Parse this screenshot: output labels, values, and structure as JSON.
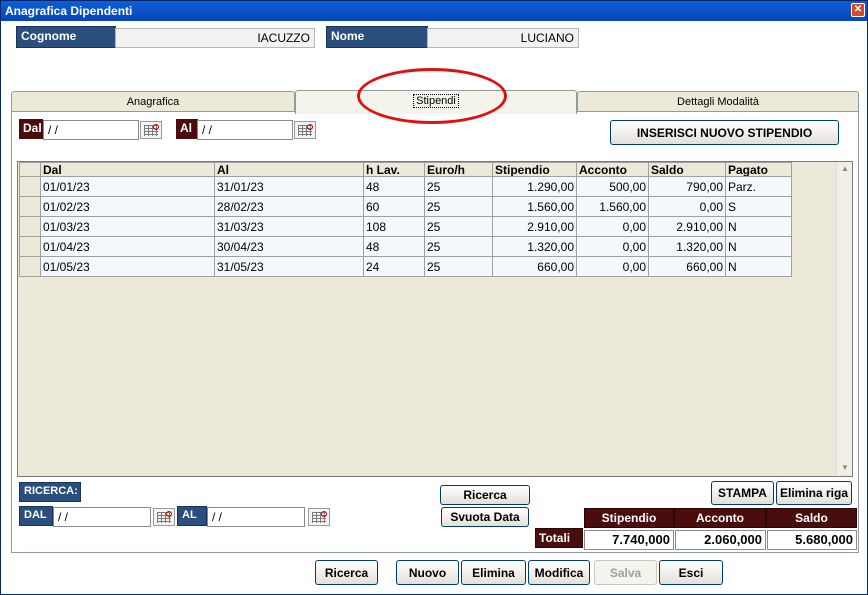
{
  "window": {
    "title": "Anagrafica Dipendenti",
    "close": "✕"
  },
  "header": {
    "cognome_label": "Cognome",
    "cognome_value": "IACUZZO",
    "nome_label": "Nome",
    "nome_value": "LUCIANO"
  },
  "tabs": [
    {
      "label": "Anagrafica"
    },
    {
      "label": "Stipendi"
    },
    {
      "label": "Dettagli Modalità"
    }
  ],
  "filter": {
    "dal_label": "Dal",
    "dal_value": " /  /",
    "al_label": "Al",
    "al_value": " /  /"
  },
  "insert_button": "INSERISCI NUOVO STIPENDIO",
  "table": {
    "headers": [
      "Dal",
      "Al",
      "h Lav.",
      "Euro/h",
      "Stipendio",
      "Acconto",
      "Saldo",
      "Pagato"
    ],
    "rows": [
      [
        "01/01/23",
        "31/01/23",
        "48",
        "25",
        "1.290,00",
        "500,00",
        "790,00",
        "Parz."
      ],
      [
        "01/02/23",
        "28/02/23",
        "60",
        "25",
        "1.560,00",
        "1.560,00",
        "0,00",
        "S"
      ],
      [
        "01/03/23",
        "31/03/23",
        "108",
        "25",
        "2.910,00",
        "0,00",
        "2.910,00",
        "N"
      ],
      [
        "01/04/23",
        "30/04/23",
        "48",
        "25",
        "1.320,00",
        "0,00",
        "1.320,00",
        "N"
      ],
      [
        "01/05/23",
        "31/05/23",
        "24",
        "25",
        "660,00",
        "0,00",
        "660,00",
        "N"
      ]
    ]
  },
  "search": {
    "title": "RICERCA:",
    "dal_label": "DAL",
    "dal_value": " /  /",
    "al_label": "AL",
    "al_value": " /  /",
    "ricerca_button": "Ricerca",
    "svuota_button": "Svuota Data"
  },
  "actions": {
    "stampa": "STAMPA",
    "elimina_riga": "Elimina riga"
  },
  "totals": {
    "label": "Totali",
    "headers": [
      "Stipendio",
      "Acconto",
      "Saldo"
    ],
    "values": [
      "7.740,000",
      "2.060,000",
      "5.680,000"
    ]
  },
  "bottom_buttons": [
    "Ricerca",
    "Nuovo",
    "Elimina",
    "Modifica",
    "Salva",
    "Esci"
  ],
  "colors": {
    "title_bar": "#0945b8",
    "label_blue": "#2a4f7e",
    "label_maroon": "#4a0d0d",
    "highlight": "#e01010"
  },
  "icons": {
    "calendar": "calendar-icon",
    "close": "close-icon"
  }
}
